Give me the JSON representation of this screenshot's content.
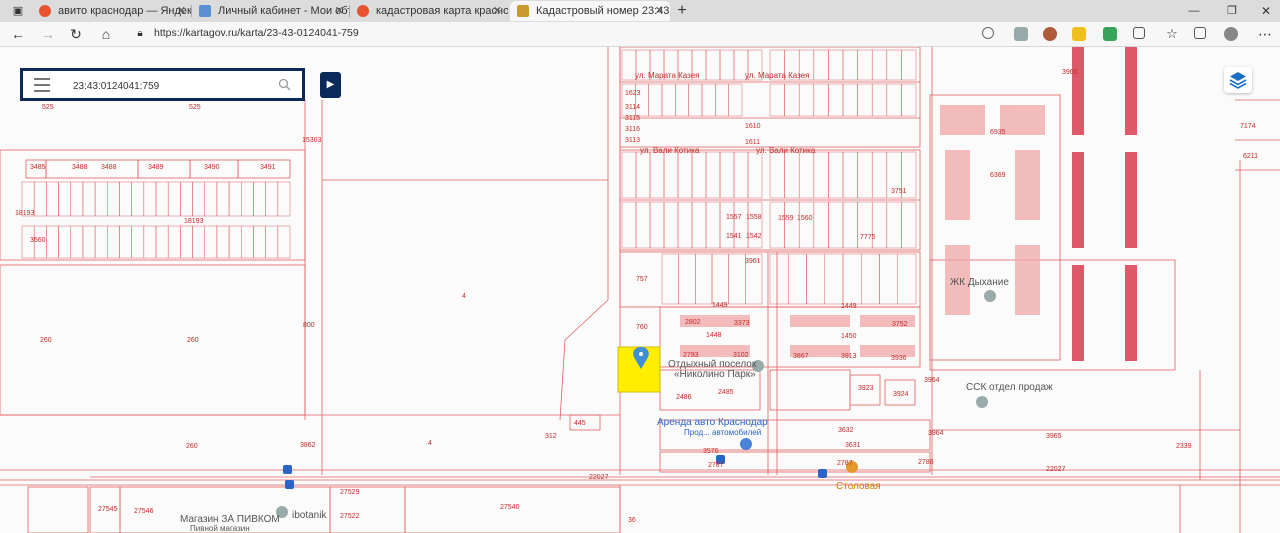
{
  "browser": {
    "tabs": [
      {
        "title": "авито краснодар — Яндекс: на",
        "favicon_color": "#e8522f"
      },
      {
        "title": "Личный кабинет - Мои объявл",
        "favicon_color": "#5b8fd6"
      },
      {
        "title": "кадастровая карта краснодар -",
        "favicon_color": "#e8522f"
      },
      {
        "title": "Кадастровый номер 23:43:0124",
        "favicon_color": "#c99a2e"
      }
    ],
    "new_tab": "+",
    "url": "https://kartagov.ru/karta/23-43-0124041-759"
  },
  "search": {
    "value": "23:43:0124041:759"
  },
  "pois": {
    "zhk": "ЖК Дыхание",
    "ssk": "ССК отдел продаж",
    "otdykh1": "Отдыхный поселок",
    "otdykh2": "«Николино Парк»",
    "arenda1": "Аренда авто Краснодар",
    "arenda2": "Прод... автомобилей",
    "stolovaya": "Столовая",
    "magazin": "Магазин ЗА ПИВКОМ",
    "magazin_sub": "Пивной магазин",
    "ibotanik": "ibotanik"
  },
  "streets": {
    "marata": "ул. Марата Казея",
    "vali": "ул. Вали Котика"
  },
  "labels": {
    "l525a": "525",
    "l525b": "525",
    "l3485": "3485",
    "l3488": "3488",
    "l3489": "3489",
    "l3490": "3490",
    "l3491": "3491",
    "l18193a": "18193",
    "l18193b": "18193",
    "l3560": "3560",
    "l15303": "15303",
    "l4a": "4",
    "l4b": "4",
    "l260a": "260",
    "l260b": "260",
    "l260c": "260",
    "l3862": "3862",
    "l800": "800",
    "l757": "757",
    "l760": "760",
    "l312": "312",
    "l445": "445",
    "l2486": "2486",
    "l2485": "2485",
    "l2793": "2793",
    "l3102": "3102",
    "l1449a": "1449",
    "l1448": "1448",
    "l1449b": "1449",
    "l1450": "1450",
    "l3867": "3867",
    "l3913": "3913",
    "l3936": "3936",
    "l2802": "2802",
    "l3373": "3373",
    "l3752": "3752",
    "l3923": "3923",
    "l3924": "3924",
    "l3632": "3632",
    "l3631": "3631",
    "l3576": "3576",
    "l2787a": "2787",
    "l2787b": "2787",
    "l2786": "2786",
    "l3964a": "3964",
    "l3964b": "3964",
    "l3965a": "3965",
    "l3965b": "3965",
    "l2339": "2339",
    "l22027a": "22027",
    "l22027b": "22027",
    "l27529": "27529",
    "l27540": "27540",
    "l27546": "27546",
    "l27545": "27545",
    "l27522": "27522",
    "l36": "36",
    "l7174": "7174",
    "l6211": "6211",
    "l3961": "3961",
    "l1557": "1557",
    "l1558": "1558",
    "l1541": "1541",
    "l1542": "1542",
    "l1559": "1559",
    "l1560": "1560",
    "l3751": "3751",
    "l7775": "7775",
    "l1610": "1610",
    "l1611": "1611",
    "l1623": "1623",
    "l3114": "3114",
    "l3115": "3115",
    "l3116": "3116",
    "l3113": "3113",
    "l6935": "6935",
    "l6369": "6369",
    "l3631b": "3631"
  },
  "colors": {
    "parcel": "#e06060",
    "highlight": "#ffee00",
    "bar": "#d9485a",
    "panel": "#0b2a5a",
    "poi": "#2b63c6"
  }
}
